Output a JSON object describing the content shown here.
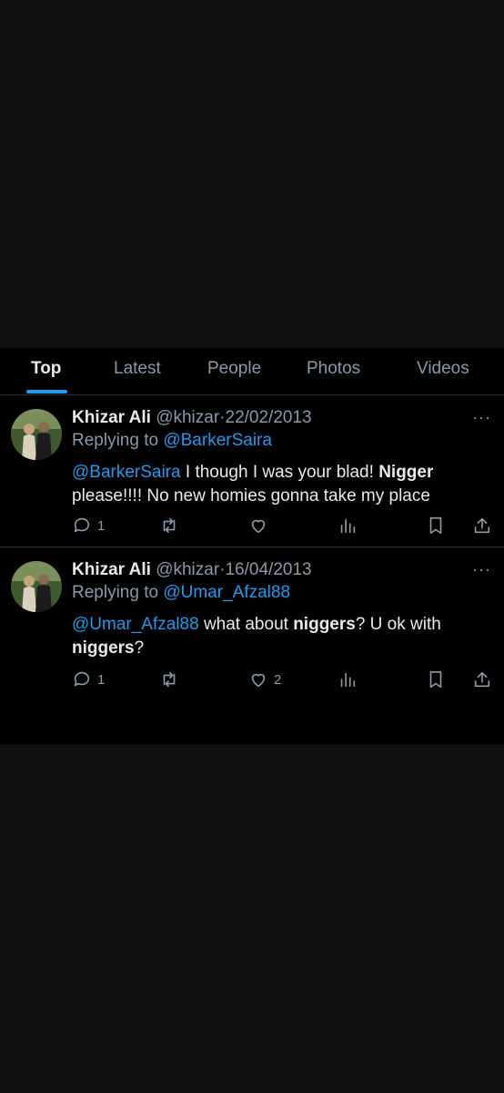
{
  "tabs": [
    {
      "label": "Top",
      "active": true
    },
    {
      "label": "Latest",
      "active": false
    },
    {
      "label": "People",
      "active": false
    },
    {
      "label": "Photos",
      "active": false
    },
    {
      "label": "Videos",
      "active": false
    }
  ],
  "tweets": [
    {
      "name": "Khizar Ali",
      "handle": "@khizar",
      "dot": "·",
      "date": "22/02/2013",
      "replying_prefix": "Replying to ",
      "replying_to": "@BarkerSaira",
      "text": {
        "mention": "@BarkerSaira",
        "part1": " I though I was your blad! ",
        "bold1": "Nigger",
        "part2": " please!!!! No new homies gonna take my place"
      },
      "replies": "1",
      "likes": ""
    },
    {
      "name": "Khizar Ali",
      "handle": "@khizar",
      "dot": "·",
      "date": "16/04/2013",
      "replying_prefix": "Replying to ",
      "replying_to": "@Umar_Afzal88",
      "text": {
        "mention": "@Umar_Afzal88",
        "part1": " what about ",
        "bold1": "niggers",
        "part2": "? U ok with ",
        "bold2": "niggers",
        "part3": "?"
      },
      "replies": "1",
      "likes": "2"
    }
  ],
  "more_icon_glyph": "···",
  "colors": {
    "background": "#000000",
    "outer_background": "#111111",
    "accent": "#1d9bf0",
    "text_primary": "#e7e9ea",
    "text_secondary": "#8b98a5",
    "divider": "#2f3336"
  },
  "icons": [
    "reply-icon",
    "retweet-icon",
    "like-icon",
    "views-icon",
    "bookmark-icon",
    "share-icon",
    "more-icon"
  ]
}
